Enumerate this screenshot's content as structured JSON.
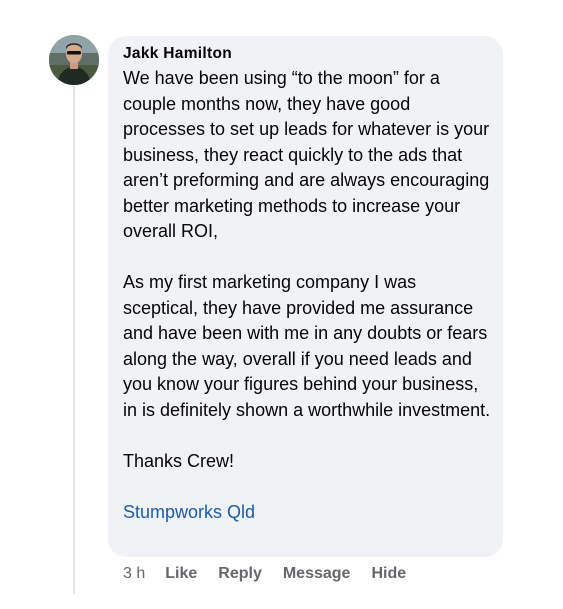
{
  "comment": {
    "author": "Jakk Hamilton",
    "avatar_icon": "user-photo-avatar",
    "paragraphs": [
      "We have been using “to the moon” for a couple months now, they have good processes to set up leads for whatever is your business, they react quickly to the ads that aren’t preforming and are always encouraging better marketing methods to increase your overall ROI,",
      "As my first marketing company I was sceptical, they have provided me assurance and have been with me in any doubts or fears along the way, overall if you need leads and you know your figures behind your business, in is definitely shown a worthwhile investment.",
      "Thanks Crew!"
    ],
    "tagged_page": "Stumpworks Qld"
  },
  "actions": {
    "timestamp": "3 h",
    "like": "Like",
    "reply": "Reply",
    "message": "Message",
    "hide": "Hide"
  },
  "colors": {
    "bubble_background": "#f0f2f5",
    "link": "#1c5ba8",
    "secondary_text": "#65676b",
    "thread_line": "#e3e5e8"
  }
}
